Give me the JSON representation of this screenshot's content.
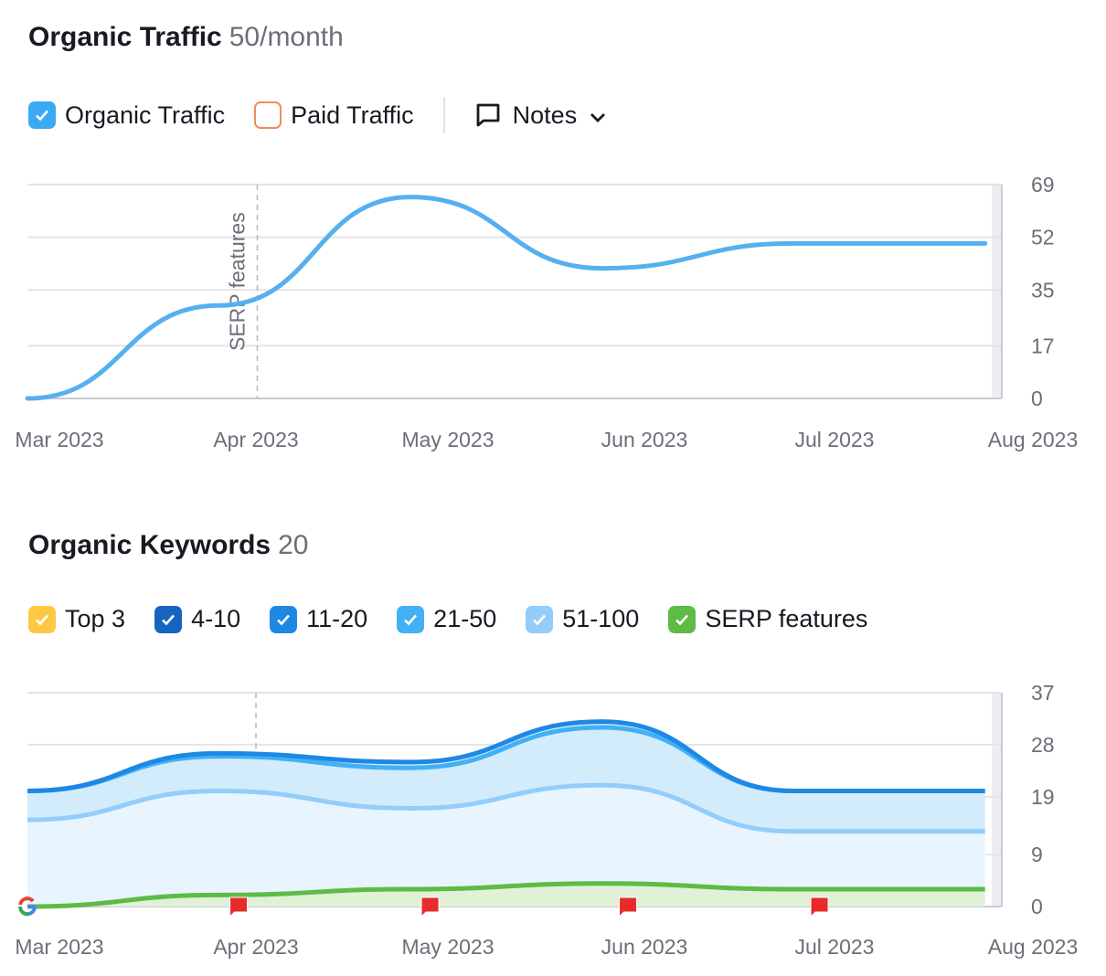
{
  "traffic": {
    "title": "Organic Traffic",
    "value": "50/month",
    "legend": [
      {
        "label": "Organic Traffic",
        "checked": true,
        "color": "#3aaaf5"
      },
      {
        "label": "Paid Traffic",
        "checked": false,
        "color": "#f08c5a"
      }
    ],
    "notes_label": "Notes",
    "annotation": "SERP features"
  },
  "keywords": {
    "title": "Organic Keywords",
    "value": "20",
    "legend": [
      {
        "label": "Top 3",
        "checked": true,
        "color": "#ffc844"
      },
      {
        "label": "4-10",
        "checked": true,
        "color": "#1565c0"
      },
      {
        "label": "11-20",
        "checked": true,
        "color": "#1e88e5"
      },
      {
        "label": "21-50",
        "checked": true,
        "color": "#42b0f5"
      },
      {
        "label": "51-100",
        "checked": true,
        "color": "#93cdfb"
      },
      {
        "label": "SERP features",
        "checked": true,
        "color": "#5dbb46"
      }
    ]
  },
  "chart_data": [
    {
      "type": "line",
      "x": [
        "2023-02-24",
        "2023-03-26",
        "2023-04-25",
        "2023-05-25",
        "2023-06-24",
        "2023-07-24"
      ],
      "series": [
        {
          "name": "Organic Traffic",
          "values": [
            0,
            30,
            65,
            42,
            50,
            50
          ],
          "color": "#56b0ef"
        }
      ],
      "x_ticks": [
        "Mar 2023",
        "Apr 2023",
        "May 2023",
        "Jun 2023",
        "Jul 2023",
        "Aug 2023"
      ],
      "y_ticks": [
        0,
        17,
        35,
        52,
        69
      ],
      "ylim": [
        0,
        69
      ],
      "grid": true,
      "annotations": [
        {
          "date": "2023-04-01",
          "label": "SERP features"
        }
      ]
    },
    {
      "type": "area",
      "stacked": true,
      "x": [
        "2023-02-24",
        "2023-03-26",
        "2023-04-25",
        "2023-05-25",
        "2023-06-24",
        "2023-07-24"
      ],
      "series": [
        {
          "name": "51-100",
          "values": [
            15,
            20,
            17,
            21,
            13,
            13
          ],
          "color": "#93cdfb"
        },
        {
          "name": "21-50",
          "values": [
            5,
            6,
            7,
            10,
            7,
            7
          ],
          "color": "#42b0f5"
        },
        {
          "name": "11-20",
          "values": [
            0,
            0.5,
            1,
            1,
            0,
            0
          ],
          "color": "#1e88e5"
        },
        {
          "name": "SERP features",
          "values": [
            0,
            2,
            3,
            4,
            3,
            3
          ],
          "color": "#5dbb46",
          "overlay": true
        }
      ],
      "x_ticks": [
        "Mar 2023",
        "Apr 2023",
        "May 2023",
        "Jun 2023",
        "Jul 2023",
        "Aug 2023"
      ],
      "y_ticks": [
        0,
        9,
        19,
        28,
        37
      ],
      "ylim": [
        0,
        37
      ],
      "grid": true,
      "markers": [
        {
          "type": "google-update",
          "date": "2023-02-24"
        },
        {
          "type": "flag",
          "date": "2023-03-29"
        },
        {
          "type": "flag",
          "date": "2023-04-28"
        },
        {
          "type": "flag",
          "date": "2023-05-29"
        },
        {
          "type": "flag",
          "date": "2023-06-28"
        }
      ]
    }
  ]
}
